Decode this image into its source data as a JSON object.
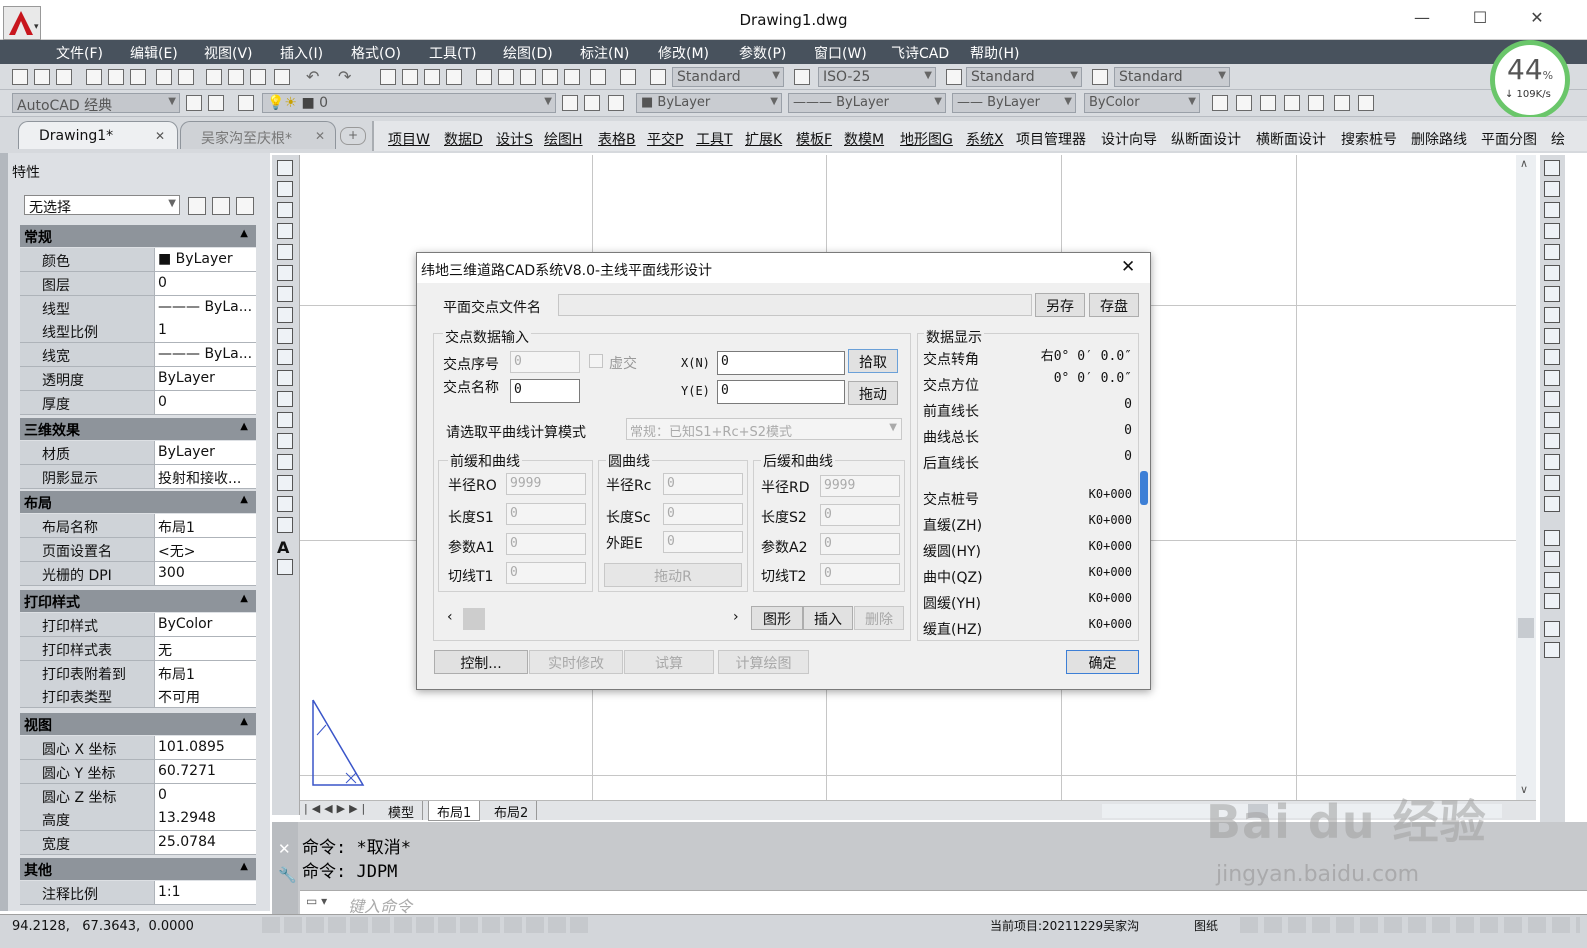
{
  "window": {
    "title": "Drawing1.dwg",
    "minimize": "—",
    "maximize": "☐",
    "close": "✕"
  },
  "menu": [
    "文件(F)",
    "编辑(E)",
    "视图(V)",
    "插入(I)",
    "格式(O)",
    "工具(T)",
    "绘图(D)",
    "标注(N)",
    "修改(M)",
    "参数(P)",
    "窗口(W)",
    "飞诗CAD",
    "帮助(H)"
  ],
  "styles": {
    "text_style": "Standard",
    "dim_style": "ISO-25",
    "table_style": "Standard",
    "mleader_style": "Standard"
  },
  "workspace": "AutoCAD 经典",
  "layer": "0",
  "layer_props": {
    "color": "ByLayer",
    "linetype": "ByLayer",
    "lineweight": "ByLayer",
    "plotstyle": "ByColor"
  },
  "network": {
    "percent": "44",
    "unit": "%",
    "speed": "↓ 109K/s"
  },
  "tabs": [
    {
      "label": "Drawing1*",
      "close": "✕"
    },
    {
      "label": "吴家沟至庆根*",
      "close": "✕"
    }
  ],
  "plugin_menu": [
    "项目W",
    "数据D",
    "设计S",
    "绘图H",
    "表格B",
    "平交P",
    "工具T",
    "扩展K",
    "模板F",
    "数模M",
    "地形图G",
    "系统X",
    "项目管理器",
    "设计向导",
    "纵断面设计",
    "横断面设计",
    "搜索桩号",
    "删除路线",
    "平面分图",
    "绘"
  ],
  "properties": {
    "panel_title": "特性",
    "selection": "无选择",
    "sections": [
      {
        "title": "常规",
        "rows": [
          [
            "颜色",
            "■ ByLayer"
          ],
          [
            "图层",
            "0"
          ],
          [
            "线型",
            "——— ByLa..."
          ],
          [
            "线型比例",
            "1"
          ],
          [
            "线宽",
            "——— ByLa..."
          ],
          [
            "透明度",
            "ByLayer"
          ],
          [
            "厚度",
            "0"
          ]
        ]
      },
      {
        "title": "三维效果",
        "rows": [
          [
            "材质",
            "ByLayer"
          ],
          [
            "阴影显示",
            "投射和接收..."
          ]
        ]
      },
      {
        "title": "布局",
        "rows": [
          [
            "布局名称",
            "布局1"
          ],
          [
            "页面设置名",
            "<无>"
          ],
          [
            "光栅的 DPI",
            "300"
          ]
        ]
      },
      {
        "title": "打印样式",
        "rows": [
          [
            "打印样式",
            "ByColor"
          ],
          [
            "打印样式表",
            "无"
          ],
          [
            "打印表附着到",
            "布局1"
          ],
          [
            "打印表类型",
            "不可用"
          ]
        ]
      },
      {
        "title": "视图",
        "rows": [
          [
            "圆心 X 坐标",
            "101.0895"
          ],
          [
            "圆心 Y 坐标",
            "60.7271"
          ],
          [
            "圆心 Z 坐标",
            "0"
          ],
          [
            "高度",
            "13.2948"
          ],
          [
            "宽度",
            "25.0784"
          ]
        ]
      },
      {
        "title": "其他",
        "rows": [
          [
            "注释比例",
            "1:1"
          ]
        ]
      }
    ]
  },
  "layout_tabs": [
    "模型",
    "布局1",
    "布局2"
  ],
  "command": {
    "line1": "命令: *取消*",
    "line2": "命令: JDPM",
    "placeholder": "键入命令"
  },
  "status": {
    "coords": "94.2128,   67.3643,  0.0000",
    "project": "当前项目:20211229吴家沟",
    "annot": "图纸"
  },
  "dialog": {
    "title": "纬地三维道路CAD系统V8.0-主线平面线形设计",
    "close": "✕",
    "file_label": "平面交点文件名",
    "file_value": "",
    "save_as": "另存",
    "save": "存盘",
    "input_group": "交点数据输入",
    "pt_no_label": "交点序号",
    "pt_no": "0",
    "virtual": "虚交",
    "pt_name_label": "交点名称",
    "pt_name": "0",
    "x_label": "X(N)",
    "x": "0",
    "y_label": "Y(E)",
    "y": "0",
    "pick": "拾取",
    "drag": "拖动",
    "mode_label": "请选取平曲线计算模式",
    "mode": "常规：已知S1+Rc+S2模式",
    "front": {
      "title": "前缓和曲线",
      "r_label": "半径RO",
      "r": "9999",
      "l_label": "长度S1",
      "l": "0",
      "a_label": "参数A1",
      "a": "0",
      "t_label": "切线T1",
      "t": "0"
    },
    "circle": {
      "title": "圆曲线",
      "r_label": "半径Rc",
      "r": "0",
      "l_label": "长度Sc",
      "l": "0",
      "e_label": "外距E",
      "e": "0",
      "drag": "拖动R"
    },
    "back": {
      "title": "后缓和曲线",
      "r_label": "半径RD",
      "r": "9999",
      "l_label": "长度S2",
      "l": "0",
      "a_label": "参数A2",
      "a": "0",
      "t_label": "切线T2",
      "t": "0"
    },
    "graph": "图形",
    "insert": "插入",
    "delete": "删除",
    "control": "控制...",
    "realtime": "实时修改",
    "trial": "试算",
    "calc_draw": "计算绘图",
    "display": {
      "title": "数据显示",
      "rows": [
        [
          "交点转角",
          "右0° 0′ 0.0″"
        ],
        [
          "交点方位",
          "0° 0′ 0.0″"
        ],
        [
          "前直线长",
          "0"
        ],
        [
          "曲线总长",
          "0"
        ],
        [
          "后直线长",
          "0"
        ]
      ],
      "stations": [
        [
          "交点桩号",
          "K0+000"
        ],
        [
          "直缓(ZH)",
          "K0+000"
        ],
        [
          "缓圆(HY)",
          "K0+000"
        ],
        [
          "曲中(QZ)",
          "K0+000"
        ],
        [
          "圆缓(YH)",
          "K0+000"
        ],
        [
          "缓直(HZ)",
          "K0+000"
        ]
      ]
    },
    "ok": "确定"
  },
  "watermark": {
    "brand": "Bai du 经验",
    "url": "jingyan.baidu.com"
  }
}
